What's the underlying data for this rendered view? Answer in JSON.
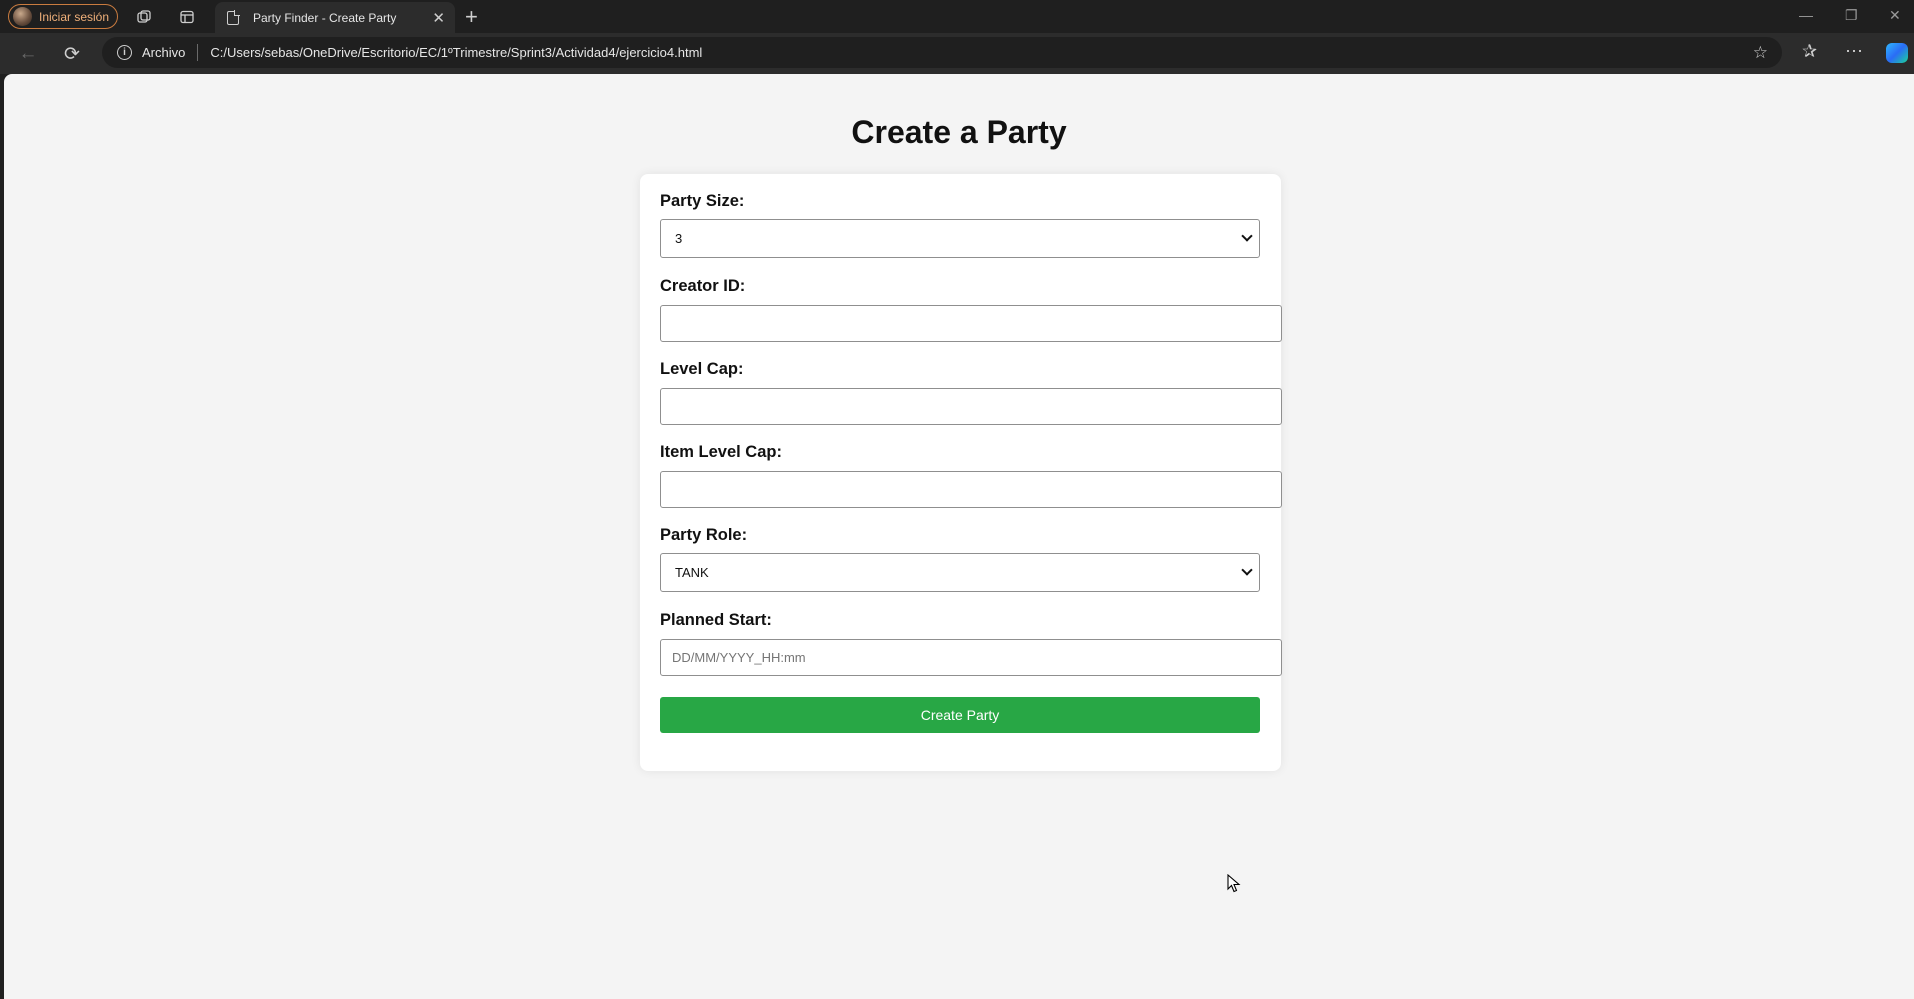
{
  "browser": {
    "profile_label": "Iniciar sesión",
    "tab_title": "Party Finder - Create Party",
    "address_prefix": "Archivo",
    "url": "C:/Users/sebas/OneDrive/Escritorio/EC/1ºTrimestre/Sprint3/Actividad4/ejercicio4.html"
  },
  "page": {
    "title": "Create a Party",
    "form": {
      "party_size": {
        "label": "Party Size:",
        "value": "3"
      },
      "creator_id": {
        "label": "Creator ID:",
        "value": ""
      },
      "level_cap": {
        "label": "Level Cap:",
        "value": ""
      },
      "item_level_cap": {
        "label": "Item Level Cap:",
        "value": ""
      },
      "party_role": {
        "label": "Party Role:",
        "value": "TANK"
      },
      "planned_start": {
        "label": "Planned Start:",
        "value": "",
        "placeholder": "DD/MM/YYYY_HH:mm"
      },
      "submit_label": "Create Party"
    }
  },
  "colors": {
    "submit_button": "#28a745",
    "page_background": "#f4f4f4",
    "chrome_background": "#1f1f1f"
  }
}
